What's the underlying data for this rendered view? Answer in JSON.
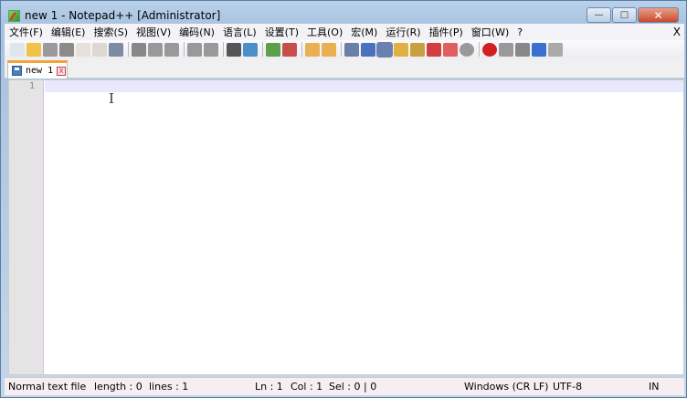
{
  "window": {
    "title": "new 1 - Notepad++ [Administrator]",
    "minimize": "—",
    "maximize": "□",
    "close": "✕"
  },
  "menu": {
    "items": [
      "文件(F)",
      "编辑(E)",
      "搜索(S)",
      "视图(V)",
      "编码(N)",
      "语言(L)",
      "设置(T)",
      "工具(O)",
      "宏(M)",
      "运行(R)",
      "插件(P)",
      "窗口(W)",
      "?"
    ],
    "close_doc": "X"
  },
  "toolbar": {
    "icons": [
      "new-file",
      "open-file",
      "save",
      "save-all",
      "close",
      "close-all",
      "print",
      "|",
      "cut",
      "copy",
      "paste",
      "|",
      "undo",
      "redo",
      "|",
      "find",
      "replace",
      "|",
      "zoom-in",
      "zoom-out",
      "|",
      "sync-vertical",
      "sync-horizontal",
      "|",
      "word-wrap",
      "show-all-chars",
      "indent-guide",
      "user-defined-language",
      "document-map",
      "function-list",
      "folder-as-workspace",
      "monitoring",
      "|",
      "record-macro",
      "stop-recording",
      "play-macro",
      "run-macro-multiple",
      "save-macro"
    ],
    "colors": [
      "#dfe6ee",
      "#f0c24a",
      "#9a9a9a",
      "#8a8a8a",
      "#e8e0d8",
      "#ddd8d0",
      "#7d8aa0",
      "|",
      "#888",
      "#999",
      "#999",
      "|",
      "#999",
      "#999",
      "|",
      "#555",
      "#4a8fc9",
      "|",
      "#5aa04a",
      "#c9504a",
      "|",
      "#e8b050",
      "#e8b050",
      "|",
      "#6a7fa8",
      "#4a70c0",
      "#6a80b0",
      "#e0b040",
      "#c9a040",
      "#d04040",
      "#e06060",
      "#999",
      "|",
      "#d02020",
      "#999",
      "#888",
      "#3a70d0",
      "#aaa"
    ]
  },
  "tab": {
    "label": "new 1",
    "close": "x"
  },
  "editor": {
    "line_numbers": [
      "1"
    ]
  },
  "status": {
    "file_type": "Normal text file",
    "length": "length : 0",
    "lines": "lines : 1",
    "ln": "Ln : 1",
    "col": "Col : 1",
    "sel": "Sel : 0 | 0",
    "eol": "Windows (CR LF)",
    "encoding": "UTF-8",
    "mode": "IN"
  }
}
